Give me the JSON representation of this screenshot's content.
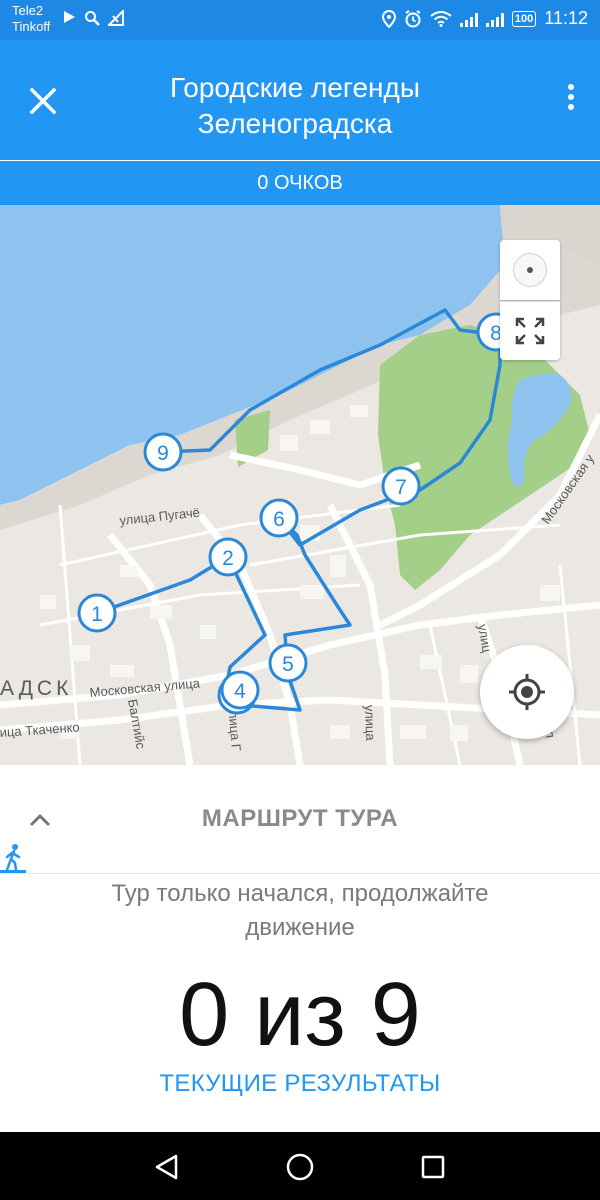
{
  "status_bar": {
    "carrier_1": "Tele2",
    "carrier_2": "Tinkoff",
    "battery": "100",
    "time": "11:12",
    "left_icons": [
      "play-icon",
      "search-icon",
      "signal-off-icon"
    ],
    "right_icons": [
      "location-icon",
      "alarm-icon",
      "wifi-icon",
      "signal-icon",
      "signal-icon"
    ]
  },
  "app_bar": {
    "title_line_1": "Городские легенды",
    "title_line_2": "Зеленоградска",
    "close_icon": "close-icon",
    "menu_icon": "more-vert-icon"
  },
  "points": "0 ОЧКОВ",
  "map": {
    "district_label": "АДСК",
    "streets": [
      "улица Пугачё",
      "Московская улица",
      "Московская у",
      "ица Ткаченко",
      "Балтийс",
      "улица Г",
      "улица",
      "улиц",
      "ул"
    ],
    "waypoints": [
      "1",
      "2",
      "3",
      "4",
      "5",
      "6",
      "7",
      "8",
      "9"
    ],
    "route_color": "#2b88d8",
    "water_color": "#8fc3ef",
    "park_color": "#a4cf89"
  },
  "sheet": {
    "title": "МАРШРУТ ТУРА",
    "message": "Тур только начался, продолжайте движение",
    "progress": "0 из 9",
    "results_link": "ТЕКУЩИЕ РЕЗУЛЬТАТЫ"
  },
  "colors": {
    "primary": "#2196f3",
    "status_bar": "#1e88e5"
  }
}
